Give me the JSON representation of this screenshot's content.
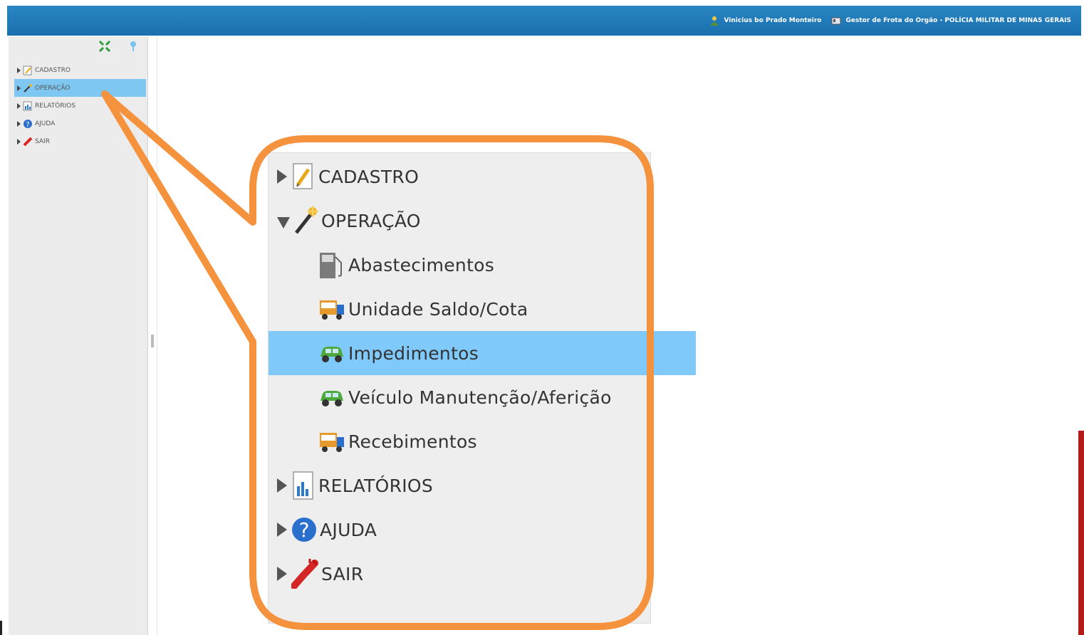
{
  "header": {
    "user_name": "Vinicius bo Prado Monteiro",
    "role_text": "Gestor de Frota do Orgão - POLÍCIA MILITAR DE MINAS GERAIS",
    "user_icon": "user-icon",
    "role_icon": "id-card-icon"
  },
  "sidebar": {
    "tools": [
      "expand-collapse-icon",
      "location-pin-icon"
    ],
    "items": [
      {
        "label": "CADASTRO",
        "icon": "edit-document-icon"
      },
      {
        "label": "OPERAÇÃO",
        "icon": "magic-wand-icon"
      },
      {
        "label": "RELATÓRIOS",
        "icon": "report-chart-icon"
      },
      {
        "label": "AJUDA",
        "icon": "help-icon"
      },
      {
        "label": "SAIR",
        "icon": "exit-plug-icon"
      }
    ]
  },
  "zoom_menu": {
    "items": [
      {
        "label": "CADASTRO",
        "icon": "edit-document-icon"
      },
      {
        "label": "OPERAÇÃO",
        "icon": "magic-wand-icon"
      },
      {
        "label": "Abastecimentos",
        "icon": "fuel-pump-icon"
      },
      {
        "label": "Unidade Saldo/Cota",
        "icon": "truck-icon"
      },
      {
        "label": "Impedimentos",
        "icon": "car-icon"
      },
      {
        "label": "Veículo Manutenção/Aferição",
        "icon": "car-icon"
      },
      {
        "label": "Recebimentos",
        "icon": "truck-icon"
      },
      {
        "label": "RELATÓRIOS",
        "icon": "report-chart-icon"
      },
      {
        "label": "AJUDA",
        "icon": "help-icon"
      },
      {
        "label": "SAIR",
        "icon": "exit-plug-icon"
      }
    ]
  },
  "colors": {
    "header": "#1f78b9",
    "selection": "#7fc9fb",
    "callout": "#f5923e",
    "panel": "#eeeeee"
  }
}
